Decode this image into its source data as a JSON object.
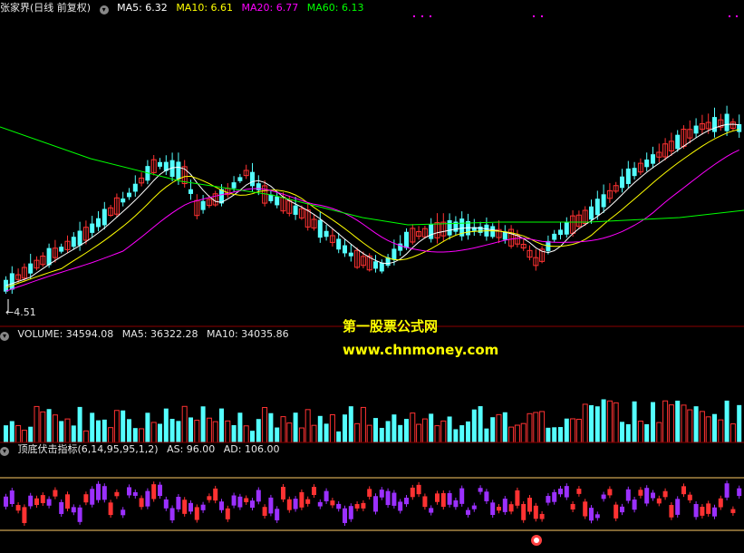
{
  "price_header": {
    "title": "张家界(日线 前复权)",
    "ma5": "MA5: 6.32",
    "ma10": "MA10: 6.61",
    "ma20": "MA20: 6.77",
    "ma60": "MA60: 6.13"
  },
  "low_marker": "4.51",
  "watermark": {
    "line1": "第一股票公式网",
    "line2": "www.chnmoney.com"
  },
  "volume_header": {
    "volume": "VOLUME: 34594.08",
    "ma5": "MA5: 36322.28",
    "ma10": "MA10: 34035.86"
  },
  "indicator_header": {
    "name": "顶底伏击指标(6,14,95,95,1,2)",
    "as": "AS: 96.00",
    "ad": "AD: 106.00"
  },
  "colors": {
    "up": "#ff3232",
    "down": "#54ffff",
    "ma5": "#ffffff",
    "ma10": "#ffff00",
    "ma20": "#ff00ff",
    "ma60": "#00ff00",
    "panel_line": "#8b0000",
    "ind_up": "#ff3232",
    "ind_down": "#9b30ff"
  }
}
